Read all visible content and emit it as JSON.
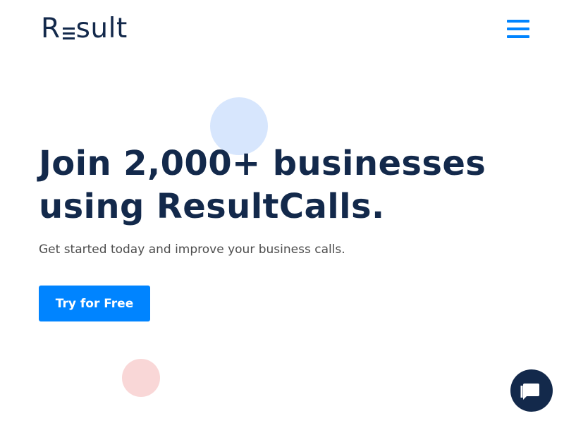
{
  "header": {
    "logo": {
      "prefix": "R",
      "suffix": "sult"
    },
    "menu_icon": "hamburger-menu-icon",
    "accent_color": "#0084ff"
  },
  "hero": {
    "title": "Join 2,000+ businesses using ResultCalls.",
    "subtitle": "Get started today and improve your business calls.",
    "cta_label": "Try for Free"
  },
  "chat_widget": {
    "icon": "chat-bubble-icon"
  },
  "colors": {
    "primary": "#0084ff",
    "heading": "#13294b",
    "body_text": "#4d4d4d",
    "decor_blue": "#d7e6fd",
    "decor_pink": "#f9d7d7"
  }
}
